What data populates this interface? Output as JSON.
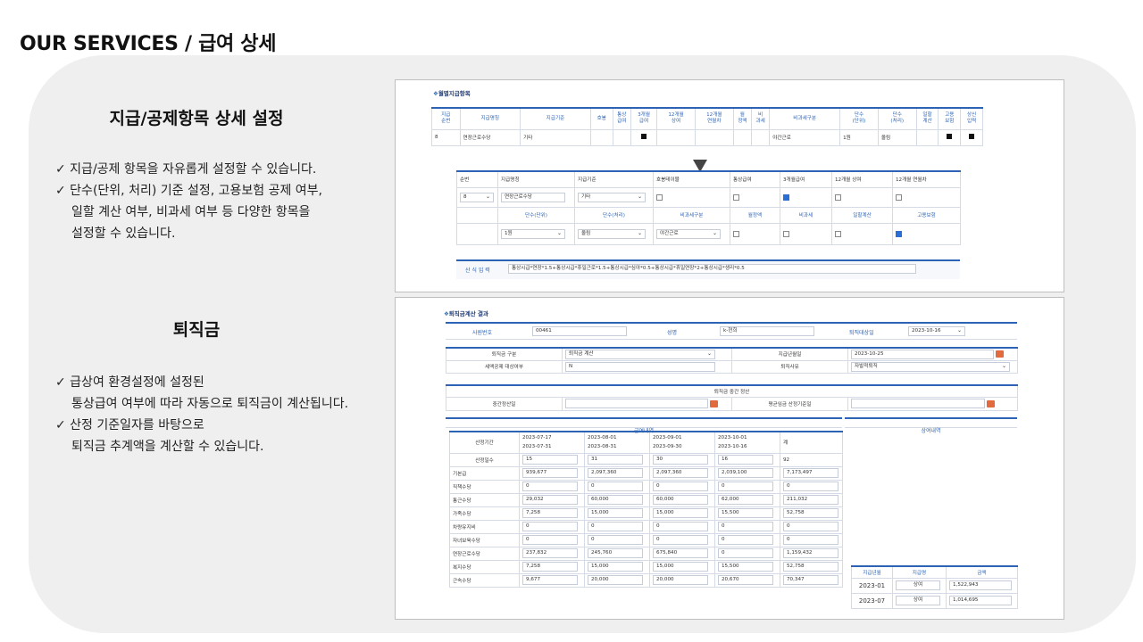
{
  "page": {
    "heading": "OUR SERVICES / 급여 상세",
    "sections": [
      {
        "title": "지급/공제항목 상세 설정",
        "bullets": [
          "✓ 지급/공제 항목을 자유롭게 설정할 수 있습니다.",
          "✓ 단수(단위, 처리) 기준 설정, 고용보험 공제 여부,",
          "일할 계산 여부, 비과세 여부 등 다양한 항목을",
          "설정할 수 있습니다."
        ]
      },
      {
        "title": "퇴직금",
        "bullets": [
          "✓ 급상여 환경설정에 설정된",
          "통상급여 여부에 따라 자동으로 퇴직금이 계산됩니다.",
          "✓ 산정 기준일자를 바탕으로",
          "퇴직금 추계액을 계산할 수 있습니다."
        ]
      }
    ]
  },
  "shot1": {
    "title": "월별지급항목",
    "headers": [
      "지급\n순번",
      "지급명칭",
      "지급기준",
      "호봉",
      "통상\n급여",
      "3개월\n급여",
      "12개월\n상여",
      "12개월\n연월차",
      "월\n정액",
      "비\n과세",
      "비과세구분",
      "단수\n(단위)",
      "단수\n(처리)",
      "일할\n계산",
      "고용\n보험",
      "상신\n입력"
    ],
    "row": [
      "8",
      "연장근로수당",
      "기타",
      "",
      "",
      "■",
      "",
      "",
      "",
      "",
      "야간근로",
      "1원",
      "올림",
      "",
      "■",
      "■"
    ],
    "form": {
      "row1_labels": [
        "순번",
        "지급명칭",
        "지급기준",
        "호봉테이블",
        "통상급여",
        "3개월급여",
        "12개월 상여",
        "12개월 연월차"
      ],
      "seq": "8",
      "name": "연장근로수당",
      "basis": "기타",
      "row2_labels": [
        "단수(단위)",
        "단수(처리)",
        "비과세구분",
        "월정액",
        "비과세",
        "일할계산",
        "고용보험"
      ],
      "unit": "1원",
      "rounding": "올림",
      "nontax_type": "야간근로",
      "formula_label": "산 식 입 력",
      "formula": "통상시급*연장*1.5+통상시급*휴일근로*1.5+통상시급*심야*0.5+통상시급*휴일연장*2+통상시급*생리*0.5"
    }
  },
  "shot2": {
    "title": "퇴직금계산 결과",
    "emp_no_label": "사원번호",
    "emp_no": "00461",
    "name_label": "성명",
    "name": "k-현희",
    "ret_date_label": "퇴직대상일",
    "ret_date": "2023-10-16",
    "type_label": "퇴직금 구분",
    "type_value": "퇴직금 계산",
    "pay_date_label": "지급년월일",
    "pay_date": "2023-10-25",
    "tax_label": "세액공제 대상여부",
    "tax_value": "N",
    "reason_label": "퇴직사유",
    "reason_value": "자발적퇴직",
    "interim_header": "퇴직금 중간 정산",
    "interim_label": "중간정산일",
    "avg_label": "평균임금 산정기준일",
    "pay_header": "급여내역",
    "bonus_header": "상여내역",
    "period_label": "산정기간",
    "periods": [
      [
        "2023-07-17",
        "2023-07-31"
      ],
      [
        "2023-08-01",
        "2023-08-31"
      ],
      [
        "2023-09-01",
        "2023-09-30"
      ],
      [
        "2023-10-01",
        "2023-10-16"
      ]
    ],
    "total_label": "계",
    "days_label": "산정일수",
    "days": [
      "15",
      "31",
      "30",
      "16",
      "92"
    ],
    "rows": [
      {
        "label": "기본급",
        "vals": [
          "939,677",
          "2,097,360",
          "2,097,360",
          "2,039,100",
          "7,173,497"
        ]
      },
      {
        "label": "직책수당",
        "vals": [
          "0",
          "0",
          "0",
          "0",
          "0"
        ]
      },
      {
        "label": "통근수당",
        "vals": [
          "29,032",
          "60,000",
          "60,000",
          "62,000",
          "211,032"
        ]
      },
      {
        "label": "가족수당",
        "vals": [
          "7,258",
          "15,000",
          "15,000",
          "15,500",
          "52,758"
        ]
      },
      {
        "label": "차량유지비",
        "vals": [
          "0",
          "0",
          "0",
          "0",
          "0"
        ]
      },
      {
        "label": "자녀보육수당",
        "vals": [
          "0",
          "0",
          "0",
          "0",
          "0"
        ]
      },
      {
        "label": "연장근로수당",
        "vals": [
          "237,832",
          "245,760",
          "675,840",
          "0",
          "1,159,432"
        ]
      },
      {
        "label": "복지수당",
        "vals": [
          "7,258",
          "15,000",
          "15,000",
          "15,500",
          "52,758"
        ]
      },
      {
        "label": "근속수당",
        "vals": [
          "9,677",
          "20,000",
          "20,000",
          "20,670",
          "70,347"
        ]
      }
    ],
    "bonus_cols": [
      "지급년월",
      "지급명",
      "금액"
    ],
    "bonus_rows": [
      [
        "2023-01",
        "상여",
        "1,522,943"
      ],
      [
        "2023-07",
        "상여",
        "1,014,695"
      ]
    ]
  }
}
